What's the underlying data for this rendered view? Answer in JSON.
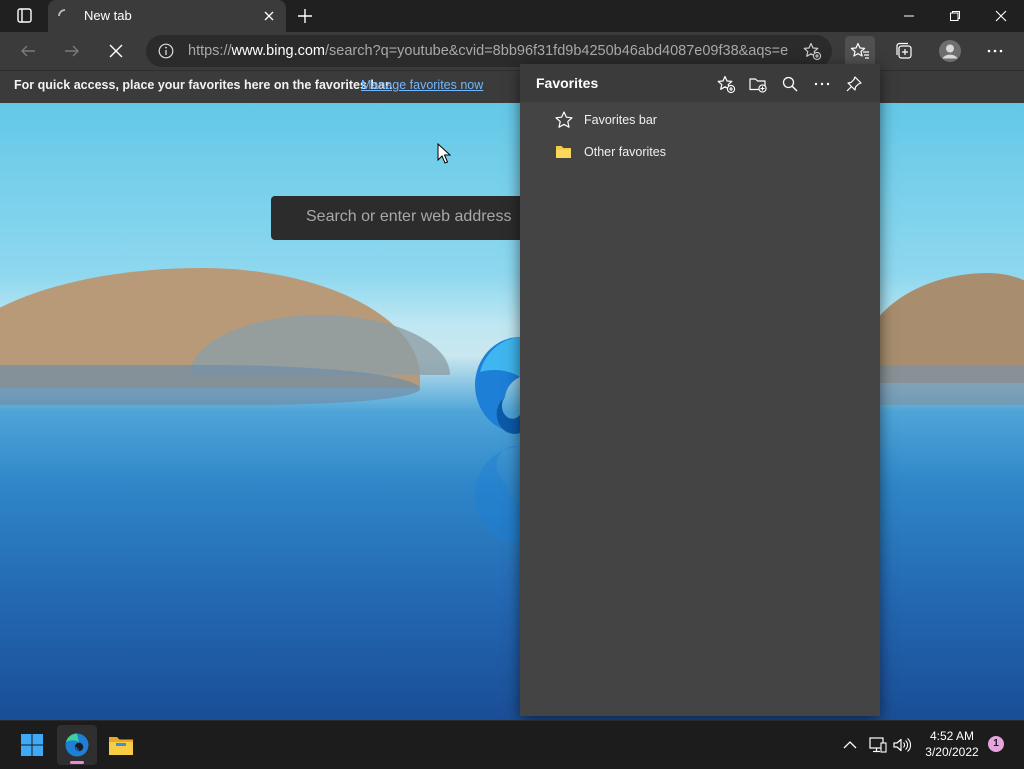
{
  "window": {
    "tab_title": "New tab"
  },
  "toolbar": {
    "url_prefix": "https://",
    "url_domain": "www.bing.com",
    "url_rest": "/search?q=youtube&cvid=8bb96f31fd9b4250b46abd4087e09f38&aqs=e..."
  },
  "favorites_bar": {
    "message": "For quick access, place your favorites here on the favorites bar.",
    "link": "Manage favorites now"
  },
  "new_tab": {
    "search_placeholder": "Search or enter web address"
  },
  "favorites_panel": {
    "title": "Favorites",
    "items": [
      {
        "label": "Favorites bar",
        "icon": "star-icon"
      },
      {
        "label": "Other favorites",
        "icon": "folder-icon"
      }
    ]
  },
  "taskbar": {
    "time": "4:52 AM",
    "date": "3/20/2022",
    "notification_count": "1"
  },
  "colors": {
    "accent": "#70b7ff",
    "folder": "#f5c842",
    "notification": "#e6a4de"
  }
}
